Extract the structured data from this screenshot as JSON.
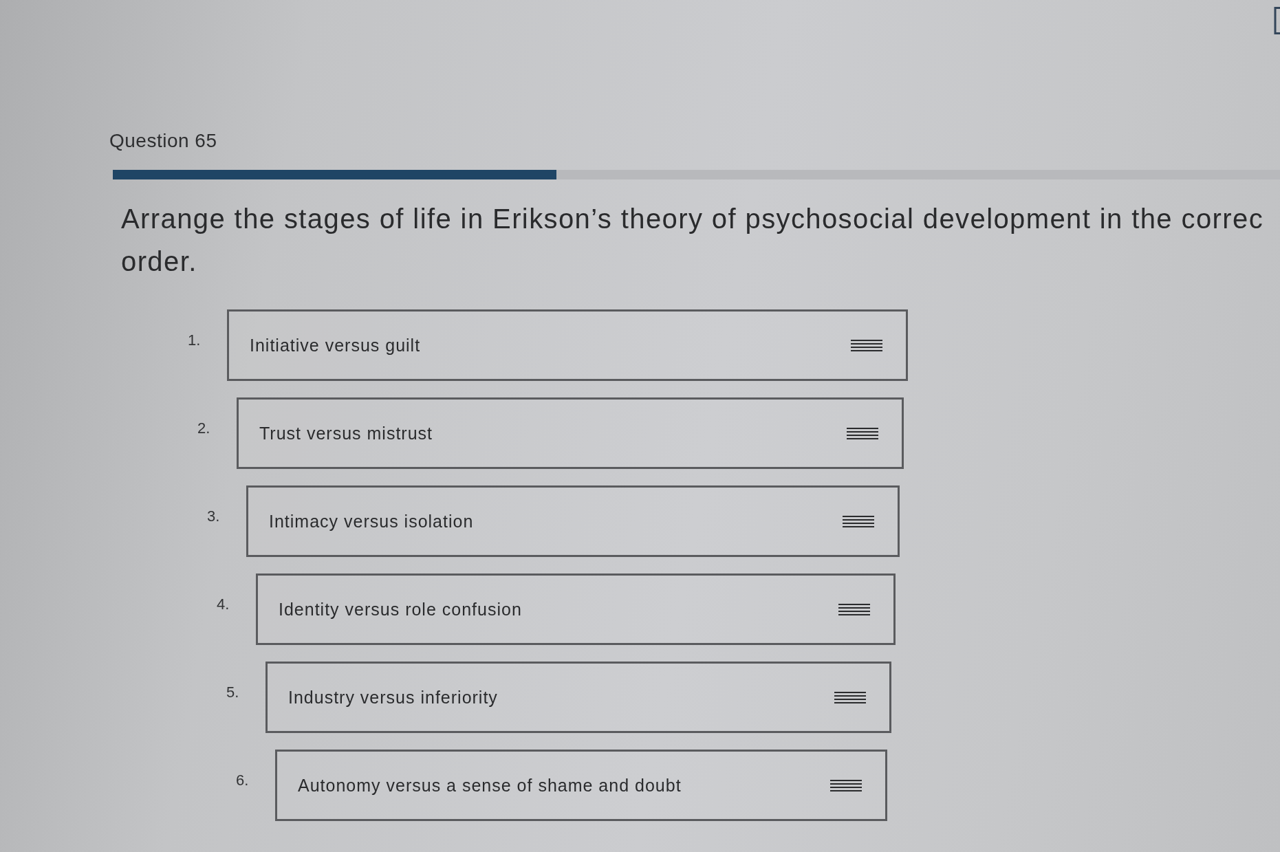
{
  "question": {
    "title": "Question 65",
    "progress": {
      "level": 0.38
    },
    "prompt": "Arrange the stages of life in Erikson’s theory of psychosocial development in the correc\norder."
  },
  "items": [
    {
      "number": "1.",
      "label": "Initiative versus guilt"
    },
    {
      "number": "2.",
      "label": "Trust versus mistrust"
    },
    {
      "number": "3.",
      "label": "Intimacy versus isolation"
    },
    {
      "number": "4.",
      "label": "Identity versus role confusion"
    },
    {
      "number": "5.",
      "label": "Industry versus inferiority"
    },
    {
      "number": "6.",
      "label": "Autonomy versus a sense of shame and doubt"
    }
  ]
}
